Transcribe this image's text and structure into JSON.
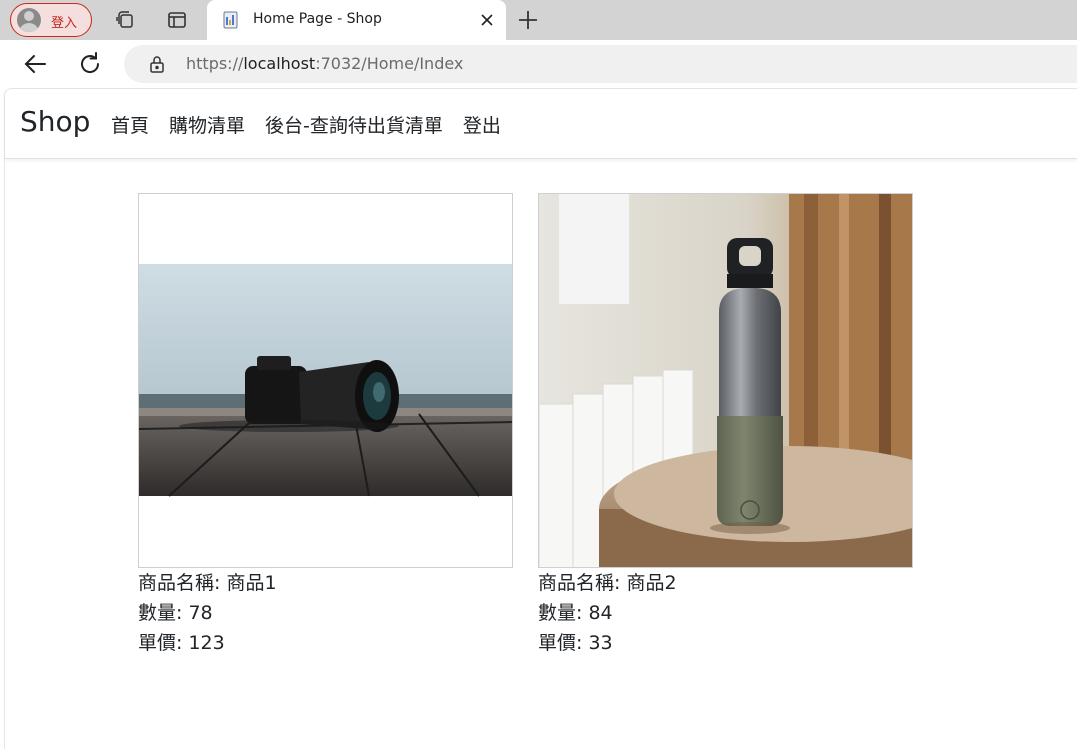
{
  "browser": {
    "profile_label": "登入",
    "tab_title": "Home Page - Shop",
    "url_scheme": "https://",
    "url_host": "localhost",
    "url_rest": ":7032/Home/Index"
  },
  "site": {
    "brand": "Shop",
    "nav": [
      "首頁",
      "購物清單",
      "後台-查詢待出貨清單",
      "登出"
    ]
  },
  "labels": {
    "name": "商品名稱: ",
    "quantity": "數量: ",
    "price": "單價: "
  },
  "products": [
    {
      "name": "商品1",
      "quantity": "78",
      "price": "123",
      "image": "camera-photo"
    },
    {
      "name": "商品2",
      "quantity": "84",
      "price": "33",
      "image": "water-bottle-photo"
    }
  ]
}
